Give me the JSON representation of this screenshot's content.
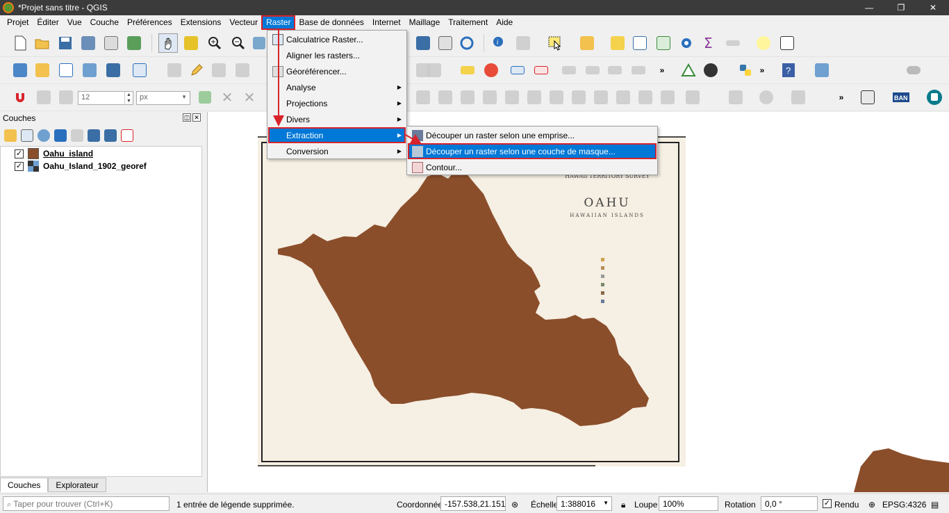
{
  "window": {
    "title": "*Projet sans titre - QGIS",
    "controls": [
      "—",
      "❐",
      "✕"
    ]
  },
  "menubar": {
    "items": [
      "Projet",
      "Éditer",
      "Vue",
      "Couche",
      "Préférences",
      "Extensions",
      "Vecteur",
      "Raster",
      "Base de données",
      "Internet",
      "Maillage",
      "Traitement",
      "Aide"
    ],
    "active": "Raster"
  },
  "raster_menu": {
    "items": [
      {
        "label": "Calculatrice Raster...",
        "has_submenu": false
      },
      {
        "label": "Aligner les rasters...",
        "has_submenu": false
      },
      {
        "label": "Géoréférencer...",
        "has_submenu": false
      },
      {
        "label": "Analyse",
        "has_submenu": true
      },
      {
        "label": "Projections",
        "has_submenu": true
      },
      {
        "label": "Divers",
        "has_submenu": true
      },
      {
        "label": "Extraction",
        "has_submenu": true,
        "highlighted": true
      },
      {
        "label": "Conversion",
        "has_submenu": true
      }
    ]
  },
  "extraction_submenu": {
    "items": [
      {
        "label": "Découper un raster selon une emprise...",
        "highlighted": false
      },
      {
        "label": "Découper un raster selon une couche de masque...",
        "highlighted": true
      },
      {
        "label": "Contour...",
        "highlighted": false
      }
    ]
  },
  "label_toolbar": {
    "font_size": "12",
    "unit": "px"
  },
  "layers_panel": {
    "title": "Couches",
    "layers": [
      {
        "name": "Oahu_island",
        "checked": true,
        "swatch_color": "#8b4e2b",
        "type": "vector"
      },
      {
        "name": "Oahu_Island_1902_georef",
        "checked": true,
        "type": "raster"
      }
    ],
    "tabs": [
      "Couches",
      "Explorateur"
    ],
    "active_tab": "Couches"
  },
  "map": {
    "map_title_lines": [
      "HAWAII TERRITORY SURVEY",
      "OAHU",
      "HAWAIIAN ISLANDS"
    ],
    "island_color": "#8b4e2b"
  },
  "statusbar": {
    "search_placeholder": "Taper pour trouver (Ctrl+K)",
    "message": "1 entrée de légende supprimée.",
    "coord_label": "Coordonnée",
    "coord_value": "-157.538,21.151",
    "scale_label": "Échelle",
    "scale_value": "1:388016",
    "magnifier_label": "Loupe",
    "magnifier_value": "100%",
    "rotation_label": "Rotation",
    "rotation_value": "0,0 °",
    "render_label": "Rendu",
    "crs_label": "EPSG:4326"
  },
  "colors": {
    "highlight": "#0078d7",
    "annotation_red": "#d8232a",
    "island": "#8b4e2b",
    "titlebar": "#3b3b3b"
  },
  "icons": {
    "toolbar": [
      "new-project-icon",
      "open-project-icon",
      "save-project-icon",
      "pan-icon",
      "zoom-in-icon",
      "zoom-out-icon",
      "identify-icon",
      "select-icon",
      "field-calculator-icon",
      "statistics-icon",
      "python-icon",
      "help-icon"
    ]
  }
}
